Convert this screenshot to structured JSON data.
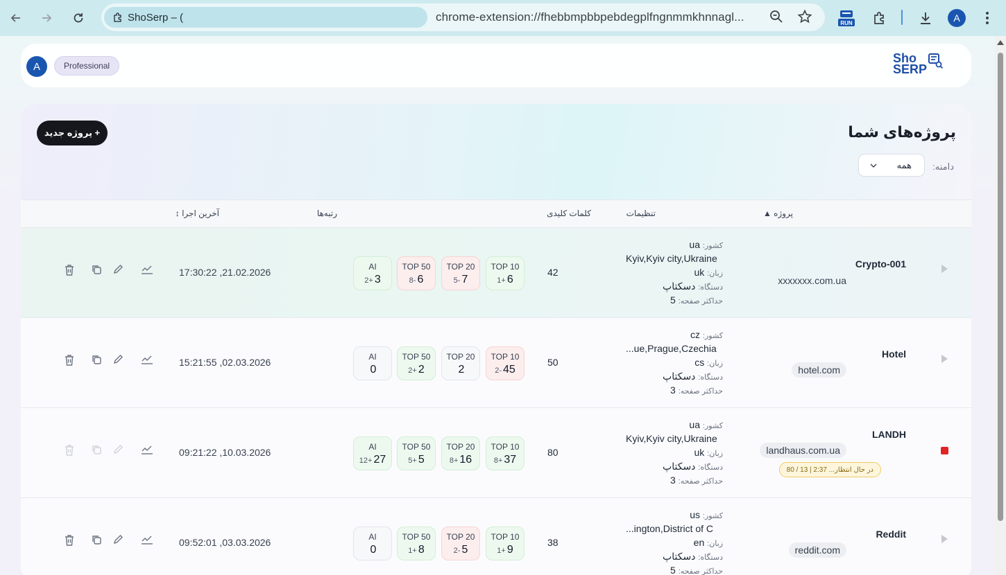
{
  "browser": {
    "tab_title": "ShoSerp – (",
    "url": "chrome-extension://fhebbmpbbpebdegplfngnmmkhnnagl...",
    "profile_initial": "A",
    "ext_badge": "RUN"
  },
  "topbar": {
    "user_initial": "A",
    "plan": "Professional",
    "logo_line1": "Sho",
    "logo_line2": "SERP"
  },
  "projects": {
    "title": "پروژه‌های شما",
    "new_button": "+ پروژه جدید",
    "domain_label": "دامنه:",
    "domain_value": "همه",
    "headers": {
      "project": "پروژه ▲",
      "settings": "تنظیمات",
      "keywords": "کلمات کلیدی",
      "ranks": "رتبه‌ها",
      "last_run": "آخرین اجرا ↕"
    },
    "setting_labels": {
      "country": "کشور:",
      "language": "زبان:",
      "device": "دستگاه:",
      "max_pages": "حداکثر صفحه:"
    },
    "rows": [
      {
        "name": "Crypto-001",
        "domain": "xxxxxxx.com.ua",
        "country": "ua",
        "city": "Kyiv,Kyiv city,Ukraine",
        "language": "uk",
        "device": "دسکتاپ",
        "max_pages": "5",
        "keywords": "42",
        "ranks": [
          {
            "label": "TOP 10",
            "value": "6",
            "delta": "+1",
            "tone": "g"
          },
          {
            "label": "TOP 20",
            "value": "7",
            "delta": "-5",
            "tone": "r"
          },
          {
            "label": "TOP 50",
            "value": "6",
            "delta": "-8",
            "tone": "r"
          },
          {
            "label": "AI",
            "value": "3",
            "delta": "+2",
            "tone": "g"
          }
        ],
        "last_run": "17:30:22 ,21.02.2026"
      },
      {
        "name": "Hotel",
        "domain": "hotel.com",
        "country": "cz",
        "city": "...ue,Prague,Czechia",
        "language": "cs",
        "device": "دسکتاپ",
        "max_pages": "3",
        "keywords": "50",
        "ranks": [
          {
            "label": "TOP 10",
            "value": "45",
            "delta": "-2",
            "tone": "r"
          },
          {
            "label": "TOP 20",
            "value": "2",
            "delta": "",
            "tone": "n"
          },
          {
            "label": "TOP 50",
            "value": "2",
            "delta": "+2",
            "tone": "g"
          },
          {
            "label": "AI",
            "value": "0",
            "delta": "",
            "tone": "n"
          }
        ],
        "last_run": "15:21:55 ,02.03.2026"
      },
      {
        "name": "LANDH",
        "domain": "landhaus.com.ua",
        "status": "در حال انتظار... 2:37  |  13 / 80",
        "country": "ua",
        "city": "Kyiv,Kyiv city,Ukraine",
        "language": "uk",
        "device": "دسکتاپ",
        "max_pages": "3",
        "keywords": "80",
        "ranks": [
          {
            "label": "TOP 10",
            "value": "37",
            "delta": "+8",
            "tone": "g"
          },
          {
            "label": "TOP 20",
            "value": "16",
            "delta": "+8",
            "tone": "g"
          },
          {
            "label": "TOP 50",
            "value": "5",
            "delta": "+5",
            "tone": "g"
          },
          {
            "label": "AI",
            "value": "27",
            "delta": "+12",
            "tone": "g"
          }
        ],
        "last_run": "09:21:22 ,10.03.2026"
      },
      {
        "name": "Reddit",
        "domain": "reddit.com",
        "country": "us",
        "city": "...ington,District of C",
        "language": "en",
        "device": "دسکتاپ",
        "max_pages": "5",
        "keywords": "38",
        "ranks": [
          {
            "label": "TOP 10",
            "value": "9",
            "delta": "+1",
            "tone": "g"
          },
          {
            "label": "TOP 20",
            "value": "5",
            "delta": "-2",
            "tone": "r"
          },
          {
            "label": "TOP 50",
            "value": "8",
            "delta": "+1",
            "tone": "g"
          },
          {
            "label": "AI",
            "value": "0",
            "delta": "",
            "tone": "n"
          }
        ],
        "last_run": "09:52:01 ,03.03.2026"
      }
    ]
  }
}
